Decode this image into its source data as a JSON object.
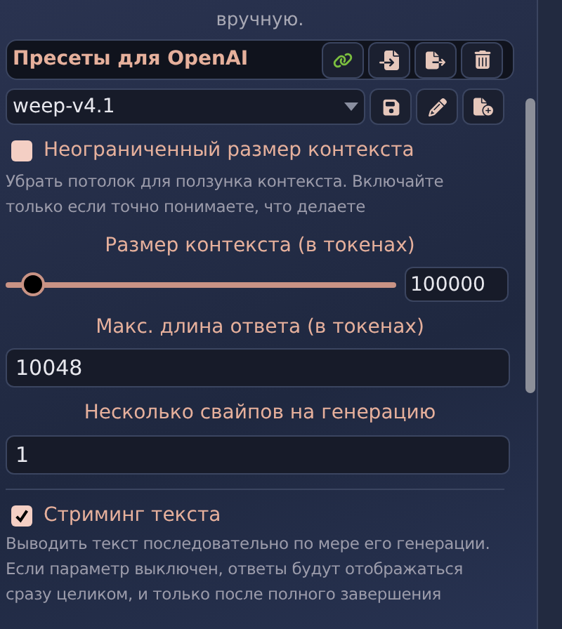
{
  "note": "вручную.",
  "presets": {
    "title": "Пресеты для OpenAI",
    "selected_preset": "weep-v4.1"
  },
  "unlimited_context": {
    "label": "Неограниченный размер контекста",
    "checked": false,
    "description": "Убрать потолок для ползунка контекста. Включайте только если точно понимаете, что делаете"
  },
  "context_size": {
    "label": "Размер контекста (в токенах)",
    "level": 0.07,
    "value": "100000"
  },
  "max_response": {
    "label": "Макс. длина ответа (в токенах)",
    "value": "10048"
  },
  "swipes": {
    "label": "Несколько свайпов на генерацию",
    "value": "1"
  },
  "streaming": {
    "label": "Стриминг текста",
    "checked": true,
    "description": [
      "Выводить текст последовательно по мере его генерации.",
      "Если параметр выключен, ответы будут отображаться сразу целиком, и только после полного завершения"
    ]
  }
}
